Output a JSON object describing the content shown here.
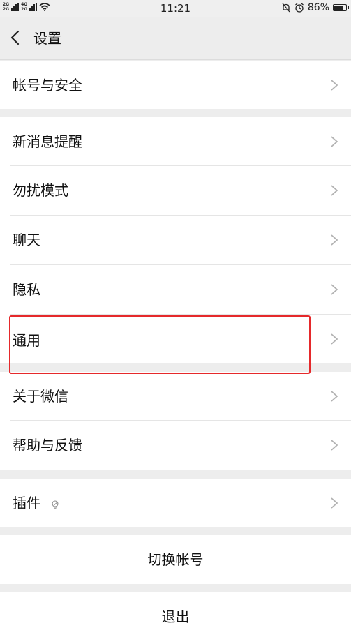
{
  "status_bar": {
    "network_top": "2G",
    "network_bottom": "2G",
    "network2_top": "4G",
    "network2_bottom": "2G",
    "time": "11:21",
    "battery_percent": "86%",
    "battery_level": 0.86
  },
  "header": {
    "title": "设置"
  },
  "sections": {
    "account": {
      "label": "帐号与安全"
    },
    "notifications": {
      "label": "新消息提醒"
    },
    "dnd": {
      "label": "勿扰模式"
    },
    "chat": {
      "label": "聊天"
    },
    "privacy": {
      "label": "隐私"
    },
    "general": {
      "label": "通用"
    },
    "about": {
      "label": "关于微信"
    },
    "help": {
      "label": "帮助与反馈"
    },
    "plugins": {
      "label": "插件"
    },
    "switch_account": {
      "label": "切换帐号"
    },
    "logout": {
      "label": "退出"
    }
  },
  "colors": {
    "highlight": "#e5292b",
    "background": "#ededed"
  }
}
